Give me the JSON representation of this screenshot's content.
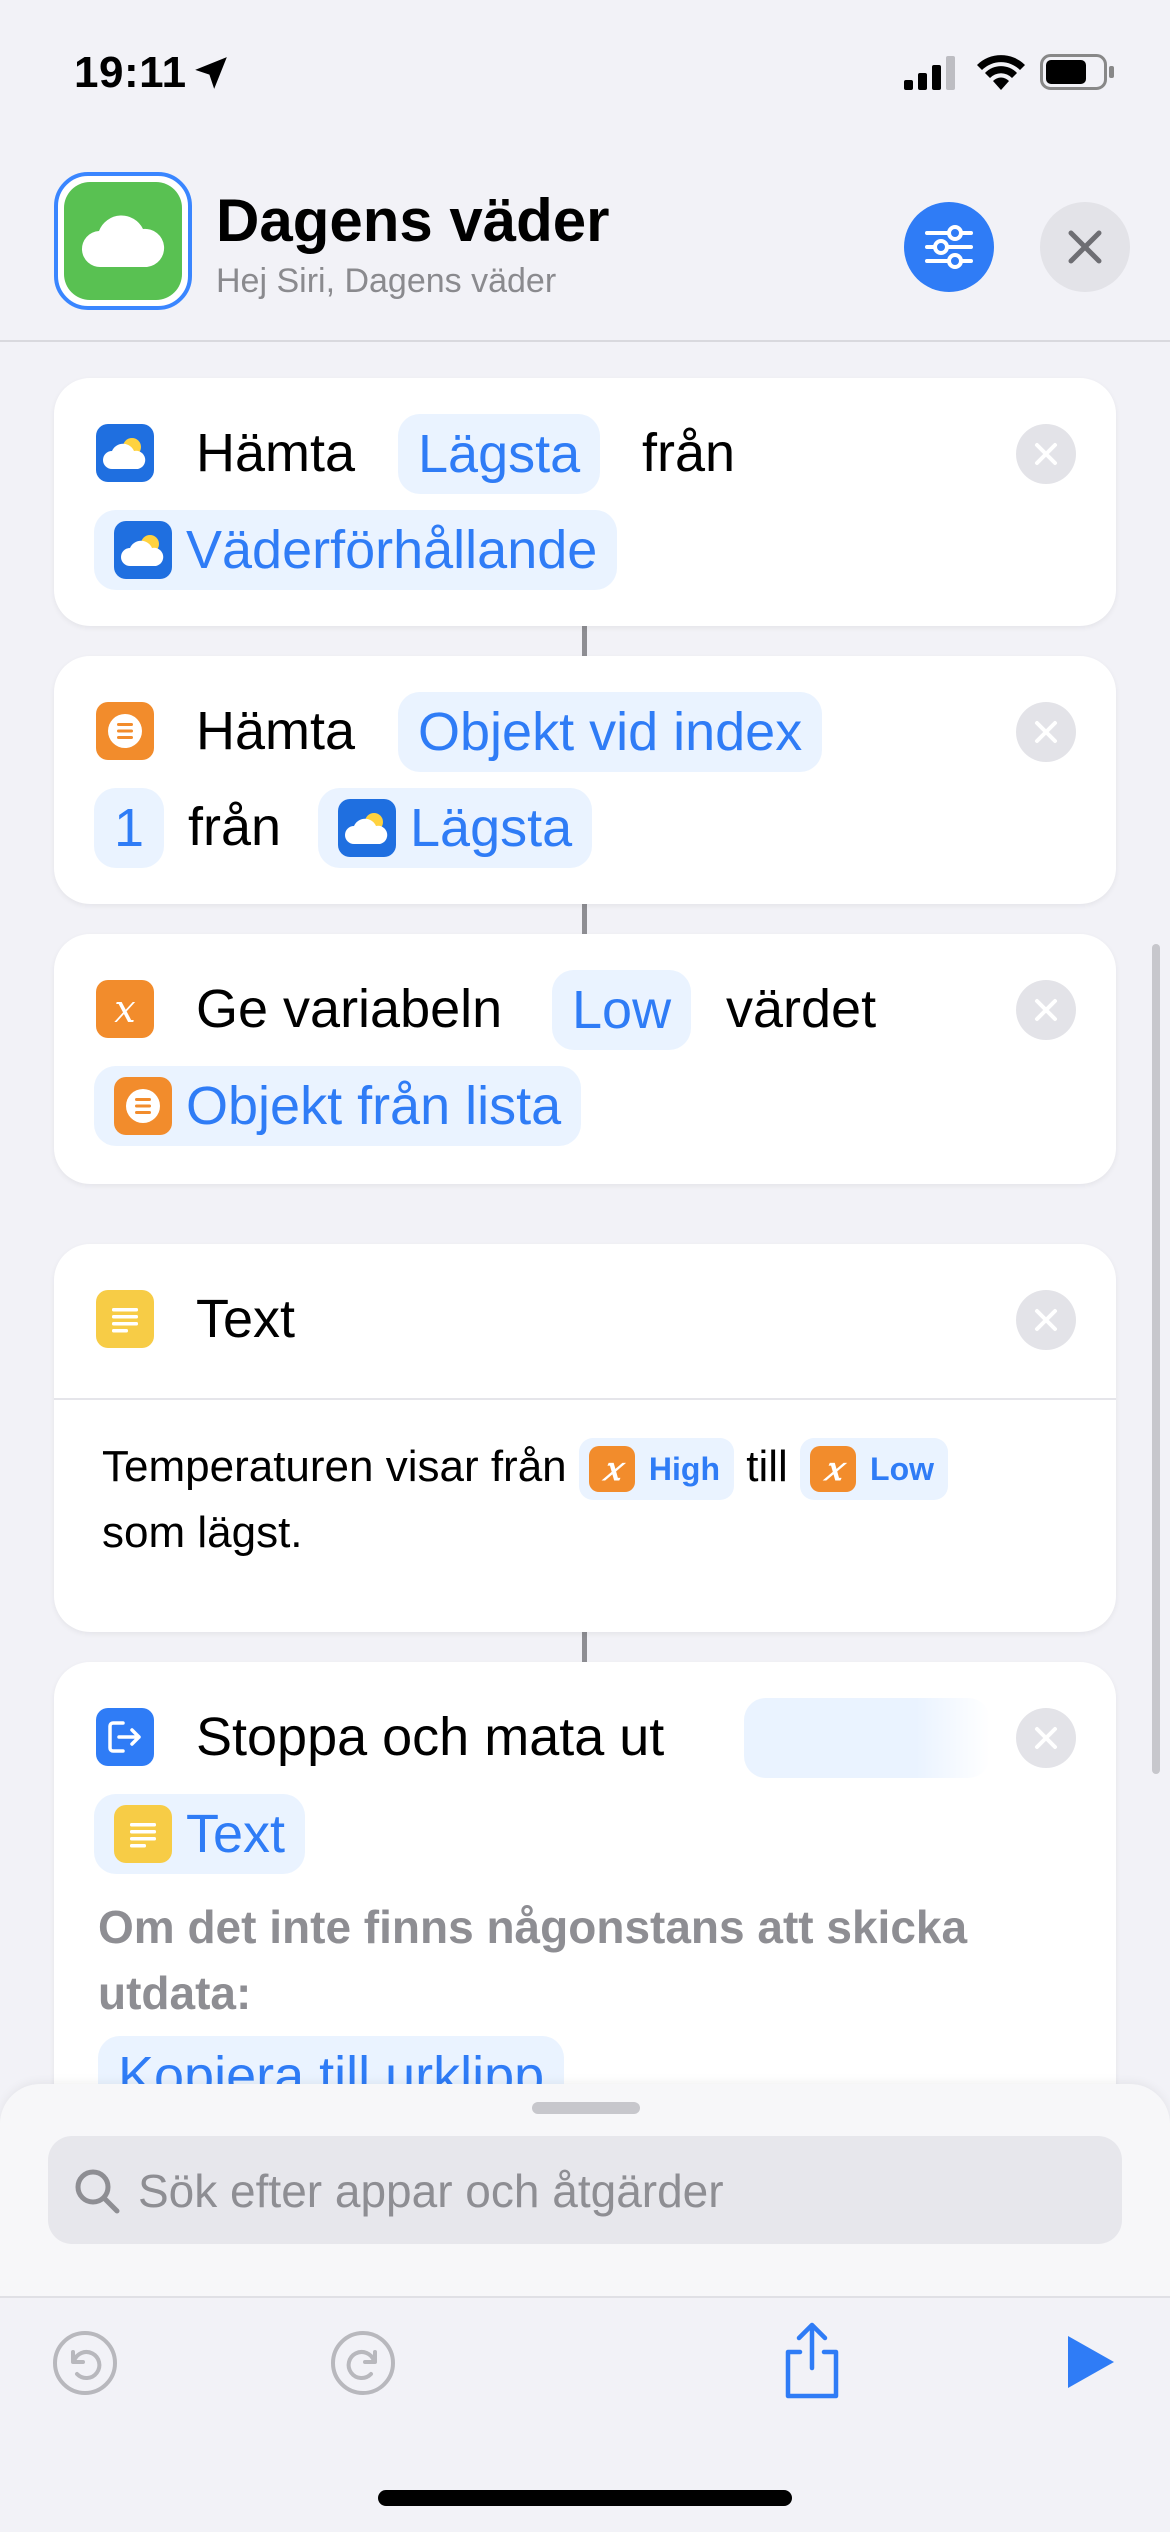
{
  "status": {
    "time": "19:11"
  },
  "header": {
    "title": "Dagens väder",
    "subtitle": "Hej Siri, Dagens väder"
  },
  "actions": [
    {
      "verb": "Hämta",
      "param": "Lägsta",
      "joiner": "från",
      "source": "Väderförhållande"
    },
    {
      "verb": "Hämta",
      "param": "Objekt vid index",
      "index": "1",
      "joiner": "från",
      "source": "Lägsta"
    },
    {
      "verb": "Ge variabeln",
      "param": "Low",
      "joiner": "värdet",
      "source": "Objekt från lista"
    },
    {
      "title": "Text",
      "text_part1": "Temperaturen visar från",
      "var1": "High",
      "text_mid": "till",
      "var2": "Low",
      "text_part2": "som lägst."
    },
    {
      "verb": "Stoppa och mata ut",
      "source": "Text",
      "fallback_label": "Om det inte finns någonstans att skicka utdata:",
      "fallback_action": "Kopiera till urklipp"
    }
  ],
  "search": {
    "placeholder": "Sök efter appar och åtgärder"
  },
  "icons": {
    "location": "location-arrow-icon",
    "signal": "cellular-signal-icon",
    "wifi": "wifi-icon",
    "battery": "battery-icon",
    "app": "cloud-icon",
    "settings": "sliders-icon",
    "close": "close-icon",
    "weather": "weather-icon",
    "list": "list-icon",
    "variable": "variable-icon",
    "text": "text-icon",
    "output": "output-icon",
    "undo": "undo-icon",
    "redo": "redo-icon",
    "share": "share-icon",
    "play": "play-icon",
    "search": "search-icon"
  },
  "colors": {
    "accent": "#2f7cf6",
    "app_green": "#59c152",
    "orange": "#f28c2c",
    "yellow": "#f7cc46"
  }
}
